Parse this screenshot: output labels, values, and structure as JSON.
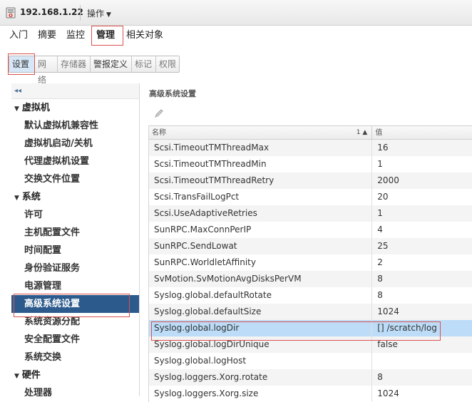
{
  "header": {
    "host": "192.168.1.22",
    "actions_label": "操作"
  },
  "main_tabs": [
    {
      "label": "入门"
    },
    {
      "label": "摘要"
    },
    {
      "label": "监控"
    },
    {
      "label": "管理",
      "active": true
    },
    {
      "label": "相关对象"
    }
  ],
  "sub_tabs": [
    {
      "label": "设置",
      "active": true
    },
    {
      "label": "网络"
    },
    {
      "label": "存储器"
    },
    {
      "label": "警报定义"
    },
    {
      "label": "标记"
    },
    {
      "label": "权限"
    }
  ],
  "nav": {
    "collapse_label": "◂◂",
    "groups": [
      {
        "label": "虚拟机",
        "items": [
          "默认虚拟机兼容性",
          "虚拟机启动/关机",
          "代理虚拟机设置",
          "交换文件位置"
        ]
      },
      {
        "label": "系统",
        "items": [
          "许可",
          "主机配置文件",
          "时间配置",
          "身份验证服务",
          "电源管理",
          "高级系统设置",
          "系统资源分配",
          "安全配置文件",
          "系统交换"
        ]
      },
      {
        "label": "硬件",
        "items": [
          "处理器"
        ]
      }
    ],
    "selected": "高级系统设置"
  },
  "panel": {
    "title": "高级系统设置",
    "columns": {
      "name": "名称",
      "sort": "1 ▲",
      "value": "值"
    },
    "rows": [
      {
        "name": "Scsi.TimeoutTMThreadMax",
        "value": "16"
      },
      {
        "name": "Scsi.TimeoutTMThreadMin",
        "value": "1"
      },
      {
        "name": "Scsi.TimeoutTMThreadRetry",
        "value": "2000"
      },
      {
        "name": "Scsi.TransFailLogPct",
        "value": "20"
      },
      {
        "name": "Scsi.UseAdaptiveRetries",
        "value": "1"
      },
      {
        "name": "SunRPC.MaxConnPerIP",
        "value": "4"
      },
      {
        "name": "SunRPC.SendLowat",
        "value": "25"
      },
      {
        "name": "SunRPC.WorldletAffinity",
        "value": "2"
      },
      {
        "name": "SvMotion.SvMotionAvgDisksPerVM",
        "value": "8"
      },
      {
        "name": "Syslog.global.defaultRotate",
        "value": "8"
      },
      {
        "name": "Syslog.global.defaultSize",
        "value": "1024"
      },
      {
        "name": "Syslog.global.logDir",
        "value": "[] /scratch/log",
        "selected": true
      },
      {
        "name": "Syslog.global.logDirUnique",
        "value": "false"
      },
      {
        "name": "Syslog.global.logHost",
        "value": ""
      },
      {
        "name": "Syslog.loggers.Xorg.rotate",
        "value": "8"
      },
      {
        "name": "Syslog.loggers.Xorg.size",
        "value": "1024"
      }
    ]
  },
  "colors": {
    "highlight_box": "#d9534f",
    "nav_selected": "#2c5a8c",
    "row_selected": "#bcdcf7"
  }
}
